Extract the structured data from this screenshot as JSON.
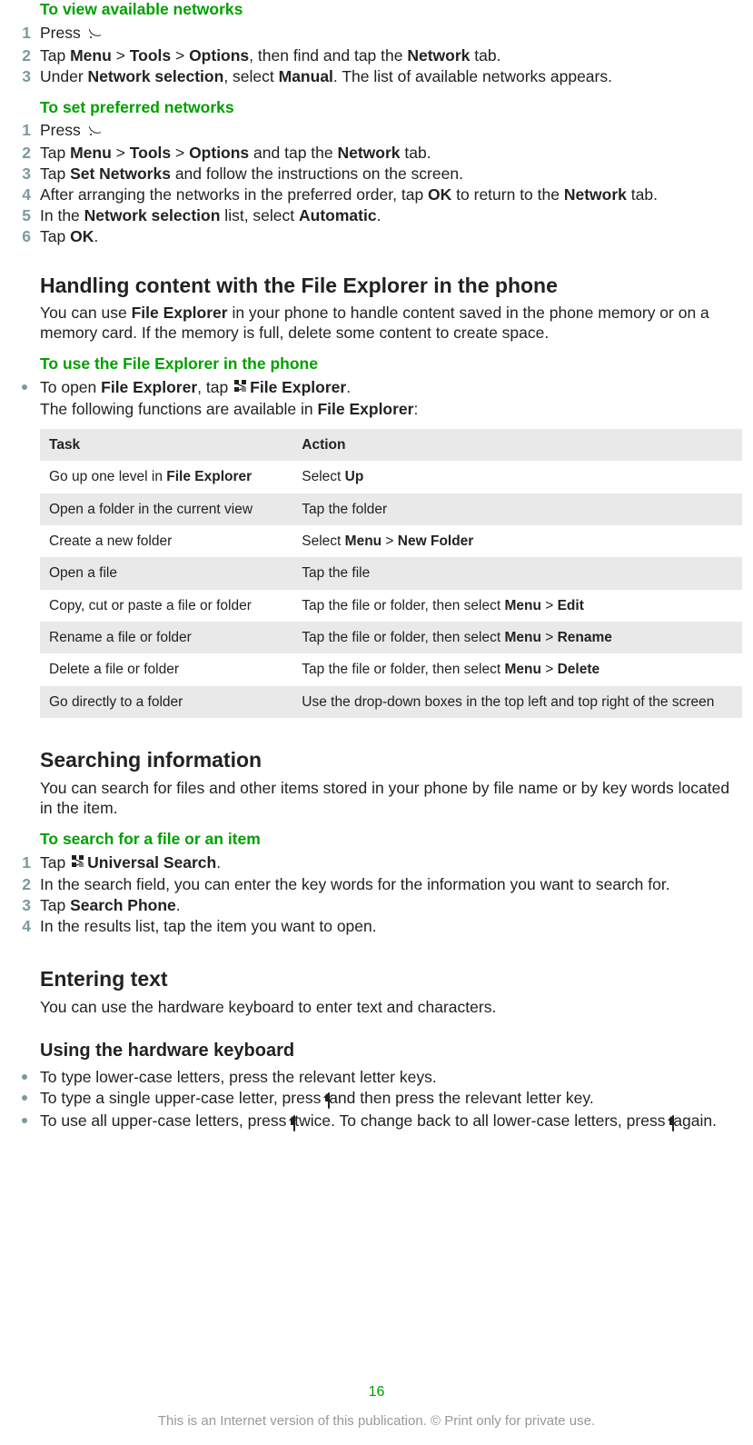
{
  "viewNetworks": {
    "title": "To view available networks",
    "steps": [
      {
        "pre": "Press ",
        "icon": "call",
        "post": " ."
      },
      {
        "parts": [
          "Tap ",
          {
            "b": "Menu"
          },
          " > ",
          {
            "b": "Tools"
          },
          " > ",
          {
            "b": "Options"
          },
          ", then find and tap the ",
          {
            "b": "Network"
          },
          " tab."
        ]
      },
      {
        "parts": [
          "Under ",
          {
            "b": "Network selection"
          },
          ", select ",
          {
            "b": "Manual"
          },
          ". The list of available networks appears."
        ]
      }
    ]
  },
  "setPreferred": {
    "title": "To set preferred networks",
    "steps": [
      {
        "pre": "Press ",
        "icon": "call",
        "post": " ."
      },
      {
        "parts": [
          "Tap ",
          {
            "b": "Menu"
          },
          " > ",
          {
            "b": "Tools"
          },
          " > ",
          {
            "b": "Options"
          },
          " and tap the ",
          {
            "b": "Network"
          },
          " tab."
        ]
      },
      {
        "parts": [
          "Tap ",
          {
            "b": "Set Networks"
          },
          " and follow the instructions on the screen."
        ]
      },
      {
        "parts": [
          "After arranging the networks in the preferred order, tap ",
          {
            "b": "OK"
          },
          " to return to the ",
          {
            "b": "Network"
          },
          " tab."
        ]
      },
      {
        "parts": [
          "In the ",
          {
            "b": "Network selection"
          },
          " list, select ",
          {
            "b": "Automatic"
          },
          "."
        ]
      },
      {
        "parts": [
          "Tap ",
          {
            "b": "OK"
          },
          "."
        ]
      }
    ]
  },
  "fileExplorer": {
    "title": "Handling content with the File Explorer in the phone",
    "intro_parts": [
      "You can use ",
      {
        "b": "File Explorer"
      },
      " in your phone to handle content saved in the phone memory or on a memory card. If the memory is full, delete some content to create space."
    ],
    "subTitle": "To use the File Explorer in the phone",
    "bullet1_parts": [
      "To open ",
      {
        "b": "File Explorer"
      },
      ", tap ",
      {
        "icon": "apps"
      },
      " > ",
      {
        "b": "File Explorer"
      },
      ".\nThe following functions are available in ",
      {
        "b": "File Explorer"
      },
      ":"
    ]
  },
  "table": {
    "headers": [
      "Task",
      "Action"
    ],
    "rows": [
      {
        "task_parts": [
          "Go up one level in ",
          {
            "b": "File Explorer"
          }
        ],
        "action_parts": [
          "Select ",
          {
            "b": "Up"
          }
        ]
      },
      {
        "task_parts": [
          "Open a folder in the current view"
        ],
        "action_parts": [
          "Tap the folder"
        ]
      },
      {
        "task_parts": [
          "Create a new folder"
        ],
        "action_parts": [
          "Select ",
          {
            "b": "Menu"
          },
          " > ",
          {
            "b": "New Folder"
          }
        ]
      },
      {
        "task_parts": [
          "Open a file"
        ],
        "action_parts": [
          "Tap the file"
        ]
      },
      {
        "task_parts": [
          "Copy, cut or paste a file or folder"
        ],
        "action_parts": [
          "Tap the file or folder, then select ",
          {
            "b": "Menu"
          },
          " > ",
          {
            "b": "Edit"
          }
        ]
      },
      {
        "task_parts": [
          "Rename a file or folder"
        ],
        "action_parts": [
          "Tap the file or folder, then select ",
          {
            "b": "Menu"
          },
          " > ",
          {
            "b": "Rename"
          }
        ]
      },
      {
        "task_parts": [
          "Delete a file or folder"
        ],
        "action_parts": [
          "Tap the file or folder, then select ",
          {
            "b": "Menu"
          },
          " > ",
          {
            "b": "Delete"
          }
        ]
      },
      {
        "task_parts": [
          "Go directly to a folder"
        ],
        "action_parts": [
          "Use the drop-down boxes in the top left and top right of the screen"
        ]
      }
    ]
  },
  "searching": {
    "title": "Searching information",
    "intro": "You can search for files and other items stored in your phone by file name or by key words located in the item.",
    "subTitle": "To search for a file or an item",
    "steps": [
      {
        "parts": [
          "Tap ",
          {
            "icon": "apps"
          },
          " > ",
          {
            "b": "Universal Search"
          },
          "."
        ]
      },
      {
        "parts": [
          "In the search field, you can enter the key words for the information you want to search for."
        ]
      },
      {
        "parts": [
          "Tap ",
          {
            "b": "Search Phone"
          },
          "."
        ]
      },
      {
        "parts": [
          "In the results list, tap the item you want to open."
        ]
      }
    ]
  },
  "enteringText": {
    "title": "Entering text",
    "intro": "You can use the hardware keyboard to enter text and characters.",
    "subTitle": "Using the hardware keyboard",
    "bullets": [
      {
        "parts": [
          "To type lower-case letters, press the relevant letter keys."
        ]
      },
      {
        "parts": [
          "To type a single upper-case letter, press ",
          {
            "icon": "shift"
          },
          " and then press the relevant letter key."
        ]
      },
      {
        "parts": [
          "To use all upper-case letters, press ",
          {
            "icon": "shift"
          },
          " twice. To change back to all lower-case letters, press ",
          {
            "icon": "shift"
          },
          " again."
        ]
      }
    ]
  },
  "pageNumber": "16",
  "footer": "This is an Internet version of this publication. © Print only for private use."
}
